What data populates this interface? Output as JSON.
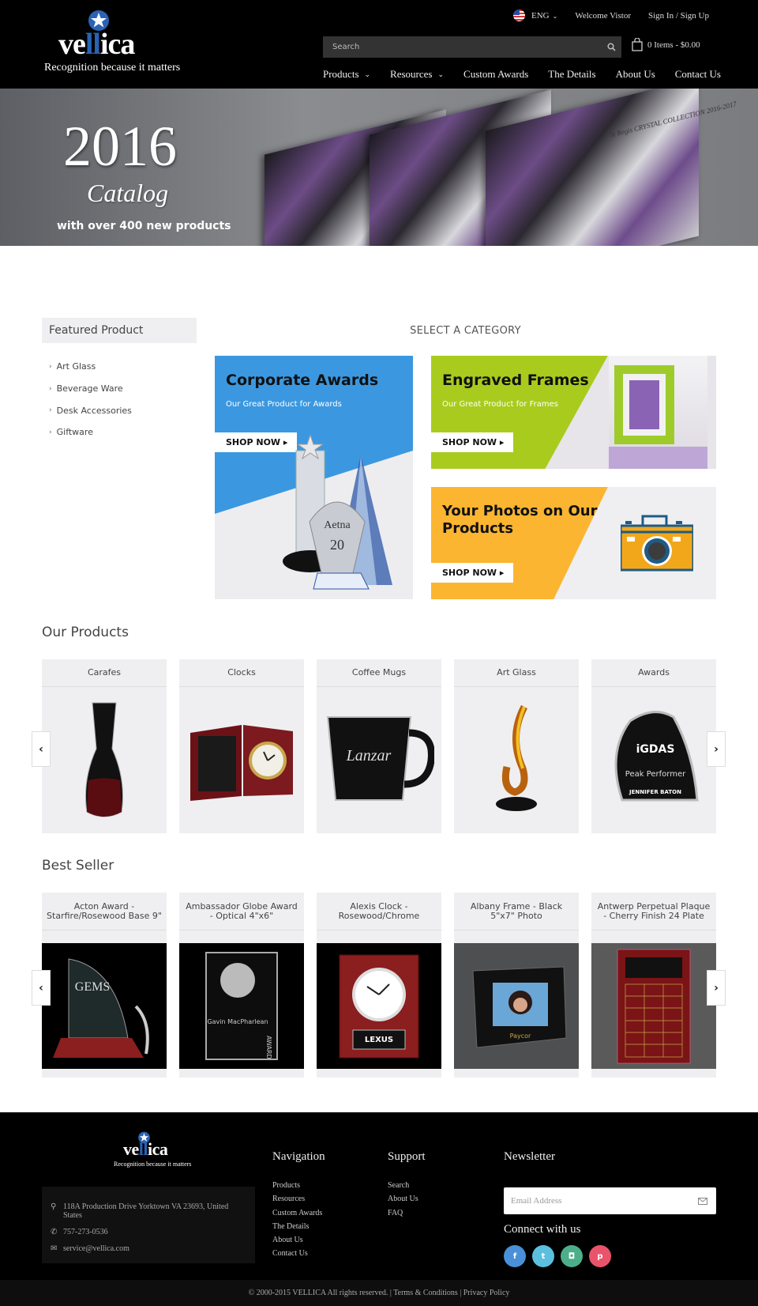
{
  "header": {
    "brand": {
      "prefix": "ve",
      "highlight": "ll",
      "suffix": "ica",
      "tagline": "Recognition because it matters"
    },
    "language": "ENG",
    "welcome": "Welcome Vistor",
    "sign_in": "Sign In / Sign Up",
    "search_placeholder": "Search",
    "cart": "0 Items - $0.00",
    "nav": [
      {
        "label": "Products",
        "dropdown": true
      },
      {
        "label": "Resources",
        "dropdown": true
      },
      {
        "label": "Custom Awards"
      },
      {
        "label": "The Details"
      },
      {
        "label": "About Us"
      },
      {
        "label": "Contact Us"
      }
    ]
  },
  "hero": {
    "year": "2016",
    "title": "Catalog",
    "subtitle": "with over 400 new products",
    "badge": "St Regis CRYSTAL COLLECTION 2016-2017"
  },
  "sidebar": {
    "title": "Featured Product",
    "items": [
      "Art Glass",
      "Beverage Ware",
      "Desk Accessories",
      "Giftware"
    ]
  },
  "categories": {
    "heading": "SELECT A CATEGORY",
    "banners": [
      {
        "title": "Corporate Awards",
        "subtitle": "Our Great Product for Awards",
        "cta": "SHOP NOW",
        "color": "#3b98e0"
      },
      {
        "title": "Engraved Frames",
        "subtitle": "Our Great Product for Frames",
        "cta": "SHOP NOW",
        "color": "#a9cb1e"
      },
      {
        "title": "Your Photos on Our Products",
        "subtitle": "",
        "cta": "SHOP NOW",
        "color": "#fbb531"
      }
    ]
  },
  "our_products": {
    "title": "Our Products",
    "items": [
      "Carafes",
      "Clocks",
      "Coffee Mugs",
      "Art Glass",
      "Awards"
    ]
  },
  "best_seller": {
    "title": "Best Seller",
    "items": [
      "Acton Award - Starfire/Rosewood Base 9\"",
      "Ambassador Globe Award - Optical 4\"x6\"",
      "Alexis Clock - Rosewood/Chrome",
      "Albany Frame - Black 5\"x7\" Photo",
      "Antwerp Perpetual Plaque - Cherry Finish 24 Plate"
    ]
  },
  "footer": {
    "address": "118A Production Drive Yorktown VA 23693, United States",
    "phone": "757-273-0536",
    "email": "service@vellica.com",
    "navigation": {
      "title": "Navigation",
      "links": [
        "Products",
        "Resources",
        "Custom Awards",
        "The Details",
        "About Us",
        "Contact Us"
      ]
    },
    "support": {
      "title": "Support",
      "links": [
        "Search",
        "About Us",
        "FAQ"
      ]
    },
    "newsletter": {
      "title": "Newsletter",
      "placeholder": "Email Address"
    },
    "connect": "Connect with us",
    "socials": [
      {
        "name": "facebook",
        "glyph": "f",
        "color": "#4a90d9"
      },
      {
        "name": "twitter",
        "glyph": "t",
        "color": "#5bc0de"
      },
      {
        "name": "instagram",
        "glyph": "◘",
        "color": "#4caf8a"
      },
      {
        "name": "pinterest",
        "glyph": "p",
        "color": "#e9546b"
      }
    ],
    "copyright": "© 2000-2015 VELLICA All rights reserved. | Terms & Conditions | Privacy Policy"
  }
}
